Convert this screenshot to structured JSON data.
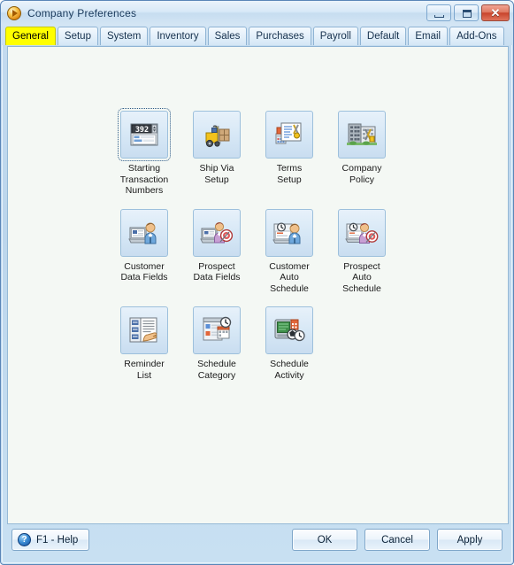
{
  "window": {
    "title": "Company Preferences",
    "app_icon": "orange-play-circle-icon",
    "controls": {
      "minimize": "minimize-icon",
      "maximize": "maximize-icon",
      "close": "✕"
    }
  },
  "tabs": [
    {
      "label": "General",
      "active": true
    },
    {
      "label": "Setup",
      "active": false
    },
    {
      "label": "System",
      "active": false
    },
    {
      "label": "Inventory",
      "active": false
    },
    {
      "label": "Sales",
      "active": false
    },
    {
      "label": "Purchases",
      "active": false
    },
    {
      "label": "Payroll",
      "active": false
    },
    {
      "label": "Default",
      "active": false
    },
    {
      "label": "Email",
      "active": false
    },
    {
      "label": "Add-Ons",
      "active": false
    }
  ],
  "rows": [
    {
      "cells": [
        {
          "label": "Starting\nTransaction\nNumbers",
          "icon": "counter-numbers-icon",
          "focused": true,
          "counter_value": "392"
        },
        {
          "label": "Ship Via\nSetup",
          "icon": "forklift-icon",
          "focused": false
        },
        {
          "label": "Terms\nSetup",
          "icon": "document-tools-icon",
          "focused": false
        },
        {
          "label": "Company\nPolicy",
          "icon": "office-building-tools-icon",
          "focused": false
        }
      ]
    },
    {
      "cells": [
        {
          "label": "Customer\nData Fields",
          "icon": "person-computer-icon",
          "focused": false
        },
        {
          "label": "Prospect\nData Fields",
          "icon": "person-computer-target-icon",
          "focused": false
        },
        {
          "label": "Customer\nAuto\nSchedule",
          "icon": "person-clock-icon",
          "focused": false
        },
        {
          "label": "Prospect\nAuto\nSchedule",
          "icon": "person-clock-target-icon",
          "focused": false
        }
      ]
    },
    {
      "cells": [
        {
          "label": "Reminder\nList",
          "icon": "reminder-list-hand-icon",
          "focused": false
        },
        {
          "label": "Schedule\nCategory",
          "icon": "schedule-category-icon",
          "focused": false
        },
        {
          "label": "Schedule\nActivity",
          "icon": "schedule-activity-icon",
          "focused": false
        }
      ]
    }
  ],
  "footer": {
    "help": {
      "label": "F1 - Help",
      "icon": "question-mark-icon",
      "glyph": "?"
    },
    "ok": "OK",
    "cancel": "Cancel",
    "apply": "Apply"
  },
  "colors": {
    "tab_active_bg": "#ffff00",
    "titlebar_text": "#1a3a5c",
    "frame_border": "#5a86b8",
    "content_bg": "#f4f8f4",
    "close_button": "#c8442c"
  }
}
